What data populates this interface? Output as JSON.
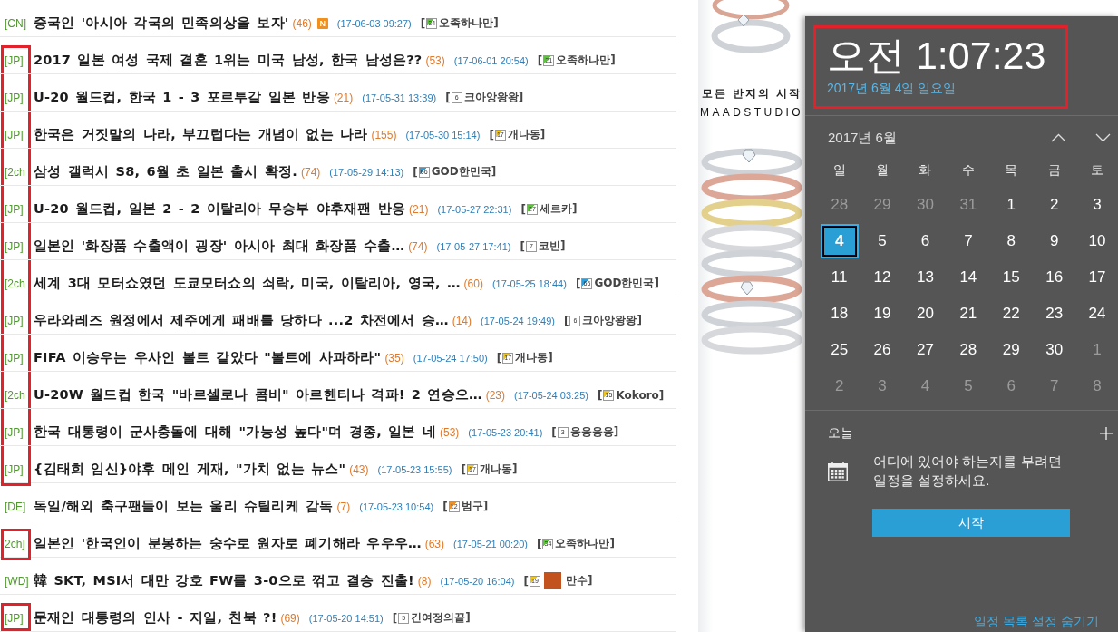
{
  "news_list": {
    "rows": [
      {
        "tag": "[CN]",
        "title": "중국인 '아시아 각국의 민족의상을 보자'",
        "count": "(46)",
        "new_badge": "N",
        "date": "(17-06-03 09:27)",
        "author": {
          "open": "[",
          "badge": "34",
          "color": "#5cc43a",
          "avatar": false,
          "name": "오족하나만",
          "close": "]"
        },
        "marked": false
      },
      {
        "tag": "[JP]",
        "title": "2017 일본 여성 국제 결혼 1위는 미국 남성, 한국 남성은??",
        "count": "(53)",
        "date": "(17-06-01 20:54)",
        "author": {
          "open": "[",
          "badge": "21",
          "color": "#5cc43a",
          "avatar": false,
          "name": "오족하나만",
          "close": "]"
        },
        "marked": true
      },
      {
        "tag": "[JP]",
        "title": "U-20 월드컵, 한국 1 - 3 포르투갈 일본 반응",
        "count": "(21)",
        "date": "(17-05-31 13:39)",
        "author": {
          "open": "[",
          "badge": "6",
          "avatar": false,
          "name": "크아앙왕왕",
          "close": "]"
        },
        "marked": true
      },
      {
        "tag": "[JP]",
        "title": "한국은 거짓말의 나라, 부끄럽다는 개념이 없는 나라",
        "count": "(155)",
        "date": "(17-05-30 15:14)",
        "author": {
          "open": "[",
          "badge": "17",
          "color": "#f0c419",
          "avatar": false,
          "name": "개나동",
          "close": "]"
        },
        "marked": true
      },
      {
        "tag": "[2ch",
        "title": "삼성 갤럭시 S8, 6월 초 일본 출시 확정.",
        "count": "(74)",
        "date": "(17-05-29 14:13)",
        "author": {
          "open": "[",
          "badge": "66",
          "color": "#2a9fe0",
          "avatar": false,
          "name": "GOD한민국",
          "close": "]"
        },
        "marked": true
      },
      {
        "tag": "[JP]",
        "title": "U-20 월드컵, 일본 2 - 2 이탈리아 무승부 야후재팬 반응",
        "count": "(21)",
        "date": "(17-05-27 22:31)",
        "author": {
          "open": "[",
          "badge": "27",
          "color": "#5cc43a",
          "avatar": false,
          "name": "세르카",
          "close": "]"
        },
        "marked": true
      },
      {
        "tag": "[JP]",
        "title": "일본인 '화장품 수출액이 굉장' 아시아 최대 화장품 수출…",
        "count": "(74)",
        "date": "(17-05-27 17:41)",
        "author": {
          "open": "[",
          "badge": "7",
          "avatar": false,
          "name": "코빈",
          "close": "]"
        },
        "marked": true
      },
      {
        "tag": "[2ch",
        "title": "세계 3대 모터쇼였던 도쿄모터쇼의 쇠락, 미국, 이탈리아, 영국, …",
        "count": "(60)",
        "date": "(17-05-25 18:44)",
        "author": {
          "open": "[",
          "badge": "66",
          "color": "#2a9fe0",
          "avatar": false,
          "name": "GOD한민국",
          "close": "]"
        },
        "marked": true
      },
      {
        "tag": "[JP]",
        "title": "우라와레즈 원정에서 제주에게 패배를 당하다 ...2 차전에서 승…",
        "count": "(14)",
        "date": "(17-05-24 19:49)",
        "author": {
          "open": "[",
          "badge": "6",
          "avatar": false,
          "name": "크아앙왕왕",
          "close": "]"
        },
        "marked": true
      },
      {
        "tag": "[JP]",
        "title": "FIFA 이승우는 우사인 볼트 같았다 \"볼트에 사과하라\"",
        "count": "(35)",
        "date": "(17-05-24 17:50)",
        "author": {
          "open": "[",
          "badge": "17",
          "color": "#f0c419",
          "avatar": false,
          "name": "개나동",
          "close": "]"
        },
        "marked": true
      },
      {
        "tag": "[2ch",
        "title": "U-20W 월드컵 한국 \"바르셀로나 콤비\" 아르헨티나 격파! 2 연승으…",
        "count": "(23)",
        "date": "(17-05-24 03:25)",
        "author": {
          "open": "[",
          "badge": "15",
          "color": "#f0c419",
          "avatar": false,
          "name": "Kokoro",
          "close": "]"
        },
        "marked": true
      },
      {
        "tag": "[JP]",
        "title": "한국 대통령이 군사충돌에 대해 \"가능성 높다\"며 경종, 일본 네",
        "count": "(53)",
        "date": "(17-05-23 20:41)",
        "author": {
          "open": "[",
          "badge": "3",
          "avatar": false,
          "name": "응응응응",
          "close": "]"
        },
        "marked": true
      },
      {
        "tag": "[JP]",
        "title": "{김태희 임신}야후 메인 게재, \"가치 없는 뉴스\"",
        "count": "(43)",
        "date": "(17-05-23 15:55)",
        "author": {
          "open": "[",
          "badge": "17",
          "color": "#f0c419",
          "avatar": false,
          "name": "개나동",
          "close": "]"
        },
        "marked": true
      },
      {
        "tag": "[DE]",
        "title": "독일/해외 축구팬들이 보는 울리 슈틸리케 감독",
        "count": "(7)",
        "date": "(17-05-23 10:54)",
        "author": {
          "open": "[",
          "badge": "12",
          "color": "#f0901e",
          "avatar": false,
          "name": "범구",
          "close": "]"
        },
        "marked": false
      },
      {
        "tag": "2ch]",
        "title": "일본인 '한국인이 분봉하는 숭수로 원자로 폐기해라 우우우…",
        "count": "(63)",
        "date": "(17-05-21 00:20)",
        "author": {
          "open": "[",
          "badge": "34",
          "color": "#5cc43a",
          "avatar": false,
          "name": "오족하나만",
          "close": "]"
        },
        "marked": true
      },
      {
        "tag": "[WD]",
        "title": "韓 SKT, MSI서 대만 강호 FW를 3-0으로 꺾고 결승 진출!",
        "count": "(8)",
        "date": "(17-05-20 16:04)",
        "author": {
          "open": "[",
          "badge": "19",
          "color": "#f0c419",
          "avatar": true,
          "name": "만수",
          "close": "]"
        },
        "marked": false
      },
      {
        "tag": "[JP]",
        "title": "문재인 대통령의 인사 - 지일, 친북 ?!",
        "count": "(69)",
        "date": "(17-05-20 14:51)",
        "author": {
          "open": "[",
          "badge": "5",
          "avatar": false,
          "name": "긴여정의끝",
          "close": "]"
        },
        "marked": true
      }
    ]
  },
  "ad": {
    "tagline": "모든 반지의 시작",
    "brand": "MAADSTUDIO"
  },
  "calendar": {
    "marked": true,
    "time": "오전 1:07:23",
    "date": "2017년 6월 4일 일요일",
    "month": "2017년 6월",
    "weekdays": [
      "일",
      "월",
      "화",
      "수",
      "목",
      "금",
      "토"
    ],
    "weeks": [
      [
        {
          "day": "28",
          "in_month": false,
          "selected": false
        },
        {
          "day": "29",
          "in_month": false,
          "selected": false
        },
        {
          "day": "30",
          "in_month": false,
          "selected": false
        },
        {
          "day": "31",
          "in_month": false,
          "selected": false
        },
        {
          "day": "1",
          "in_month": true,
          "selected": false
        },
        {
          "day": "2",
          "in_month": true,
          "selected": false
        },
        {
          "day": "3",
          "in_month": true,
          "selected": false
        }
      ],
      [
        {
          "day": "4",
          "in_month": true,
          "selected": true
        },
        {
          "day": "5",
          "in_month": true,
          "selected": false
        },
        {
          "day": "6",
          "in_month": true,
          "selected": false
        },
        {
          "day": "7",
          "in_month": true,
          "selected": false
        },
        {
          "day": "8",
          "in_month": true,
          "selected": false
        },
        {
          "day": "9",
          "in_month": true,
          "selected": false
        },
        {
          "day": "10",
          "in_month": true,
          "selected": false
        }
      ],
      [
        {
          "day": "11",
          "in_month": true,
          "selected": false
        },
        {
          "day": "12",
          "in_month": true,
          "selected": false
        },
        {
          "day": "13",
          "in_month": true,
          "selected": false
        },
        {
          "day": "14",
          "in_month": true,
          "selected": false
        },
        {
          "day": "15",
          "in_month": true,
          "selected": false
        },
        {
          "day": "16",
          "in_month": true,
          "selected": false
        },
        {
          "day": "17",
          "in_month": true,
          "selected": false
        }
      ],
      [
        {
          "day": "18",
          "in_month": true,
          "selected": false
        },
        {
          "day": "19",
          "in_month": true,
          "selected": false
        },
        {
          "day": "20",
          "in_month": true,
          "selected": false
        },
        {
          "day": "21",
          "in_month": true,
          "selected": false
        },
        {
          "day": "22",
          "in_month": true,
          "selected": false
        },
        {
          "day": "23",
          "in_month": true,
          "selected": false
        },
        {
          "day": "24",
          "in_month": true,
          "selected": false
        }
      ],
      [
        {
          "day": "25",
          "in_month": true,
          "selected": false
        },
        {
          "day": "26",
          "in_month": true,
          "selected": false
        },
        {
          "day": "27",
          "in_month": true,
          "selected": false
        },
        {
          "day": "28",
          "in_month": true,
          "selected": false
        },
        {
          "day": "29",
          "in_month": true,
          "selected": false
        },
        {
          "day": "30",
          "in_month": true,
          "selected": false
        },
        {
          "day": "1",
          "in_month": false,
          "selected": false
        }
      ],
      [
        {
          "day": "2",
          "in_month": false,
          "selected": false
        },
        {
          "day": "3",
          "in_month": false,
          "selected": false
        },
        {
          "day": "4",
          "in_month": false,
          "selected": false
        },
        {
          "day": "5",
          "in_month": false,
          "selected": false
        },
        {
          "day": "6",
          "in_month": false,
          "selected": false
        },
        {
          "day": "7",
          "in_month": false,
          "selected": false
        },
        {
          "day": "8",
          "in_month": false,
          "selected": false
        }
      ]
    ],
    "agenda": {
      "heading": "오늘",
      "message": "어디에 있어야 하는지를 부려면 일정을 설정하세요.",
      "button": "시작",
      "link": "일정 목록 설정 숨기기"
    }
  }
}
